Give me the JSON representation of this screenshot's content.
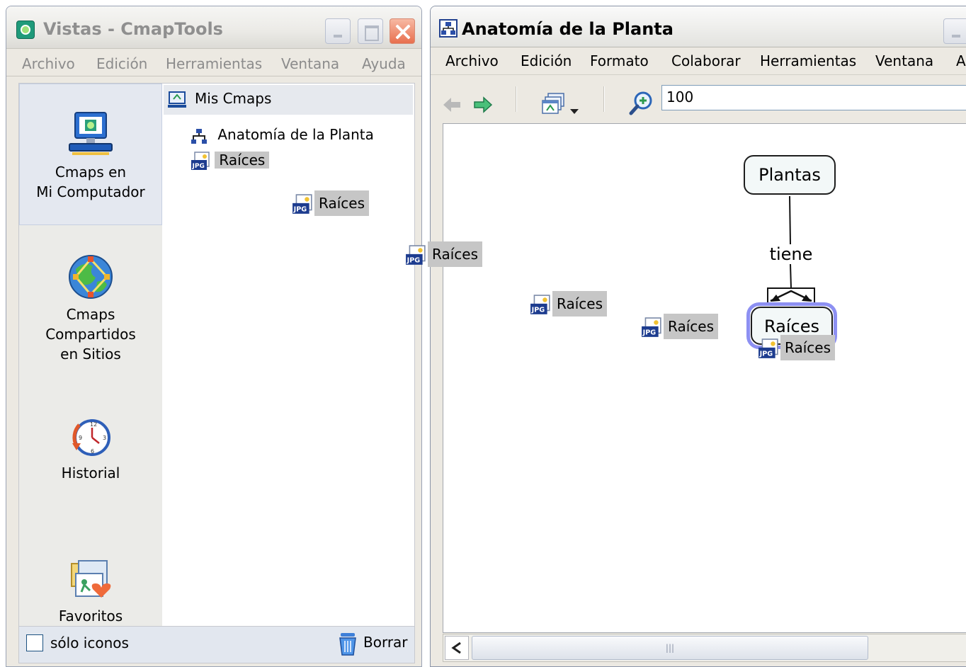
{
  "left_window": {
    "title": "Vistas - CmapTools",
    "menu": [
      "Archivo",
      "Edición",
      "Herramientas",
      "Ventana",
      "Ayuda"
    ],
    "nav": [
      {
        "label_line1": "Cmaps en",
        "label_line2": "Mi Computador",
        "icon": "computer-icon",
        "selected": true
      },
      {
        "label_line1": "Cmaps Compartidos",
        "label_line2": "en Sitios",
        "icon": "globe-network-icon"
      },
      {
        "label_line1": "Historial",
        "label_line2": "",
        "icon": "clock-history-icon"
      },
      {
        "label_line1": "Favoritos",
        "label_line2": "",
        "icon": "favorites-folder-icon"
      }
    ],
    "tree": {
      "root": "Mis Cmaps",
      "items": [
        "Anatomía de la Planta",
        "Raíces"
      ]
    },
    "footer": {
      "checkbox_label": "sólo iconos",
      "delete_label": "Borrar"
    }
  },
  "right_window": {
    "title": "Anatomía de la Planta",
    "menu": [
      "Archivo",
      "Edición",
      "Formato",
      "Colaborar",
      "Herramientas",
      "Ventana",
      "A"
    ],
    "zoom_value": "100",
    "scroll_grip": "|||",
    "concept_map": {
      "concepts": [
        "Plantas",
        "Raíces"
      ],
      "linking_phrase": "tiene"
    }
  },
  "drag_ghosts": [
    "Raíces",
    "Raíces",
    "Raíces",
    "Raíces",
    "Raíces"
  ]
}
